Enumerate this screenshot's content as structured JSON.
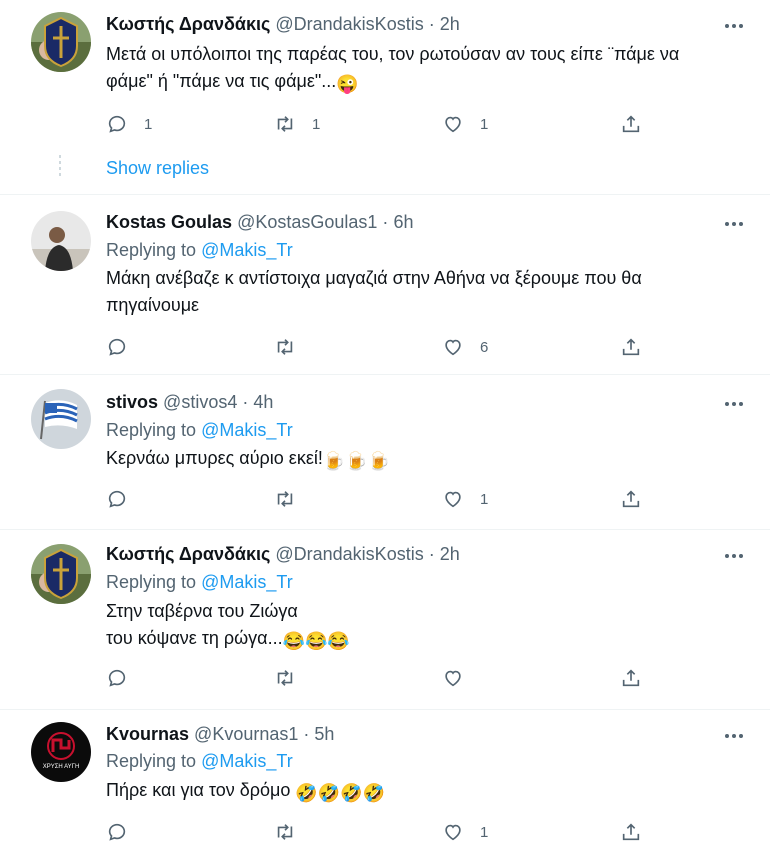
{
  "tweets": [
    {
      "name": "Κωστής Δρανδάκις",
      "handle": "@DrandakisKostis",
      "dot": "·",
      "time": "2h",
      "replying_label": "",
      "mention": "",
      "lines": [
        "Μετά οι υπόλοιποι της παρέας του, τον ρωτούσαν αν τους είπε ¨πάμε να",
        "φάμε\"  ή  \"πάμε να τις φάμε\"..."
      ],
      "emoji_line2": "😜",
      "reply_count": "1",
      "retweet_count": "1",
      "like_count": "1",
      "show_replies": "Show replies"
    },
    {
      "name": "Kostas Goulas",
      "handle": "@KostasGoulas1",
      "dot": "·",
      "time": "6h",
      "replying_label": "Replying to",
      "mention": "@Makis_Tr",
      "lines": [
        "Μάκη ανέβαζε κ αντίστοιχα μαγαζιά στην Αθήνα να ξέρουμε που θα",
        "πηγαίνουμε"
      ],
      "reply_count": "",
      "retweet_count": "",
      "like_count": "6"
    },
    {
      "name": "stivos",
      "handle": "@stivos4",
      "dot": "·",
      "time": "4h",
      "replying_label": "Replying to",
      "mention": "@Makis_Tr",
      "lines": [
        "Κερνάω μπυρες αύριο εκεί!"
      ],
      "emoji_line1": "🍺🍺🍺",
      "reply_count": "",
      "retweet_count": "",
      "like_count": "1"
    },
    {
      "name": "Κωστής Δρανδάκις",
      "handle": "@DrandakisKostis",
      "dot": "·",
      "time": "2h",
      "replying_label": "Replying to",
      "mention": "@Makis_Tr",
      "lines": [
        "Στην ταβέρνα του Ζιώγα",
        "του κόψανε τη ρώγα..."
      ],
      "emoji_line2": "😂😂😂",
      "reply_count": "",
      "retweet_count": "",
      "like_count": ""
    },
    {
      "name": "Κvournas",
      "handle": "@Kvournas1",
      "dot": "·",
      "time": "5h",
      "replying_label": "Replying to",
      "mention": "@Makis_Tr",
      "lines": [
        "Πήρε και για τον δρόμο"
      ],
      "emoji_line1": "🤣🤣🤣🤣",
      "avatar_text": "ΧΡΥΣΗ ΑΥΓΗ",
      "reply_count": "",
      "retweet_count": "",
      "like_count": "1"
    }
  ],
  "colors": {
    "link": "#1d9bf0",
    "secondary": "#536471",
    "primary": "#0f1419",
    "divider": "#eff3f4"
  }
}
